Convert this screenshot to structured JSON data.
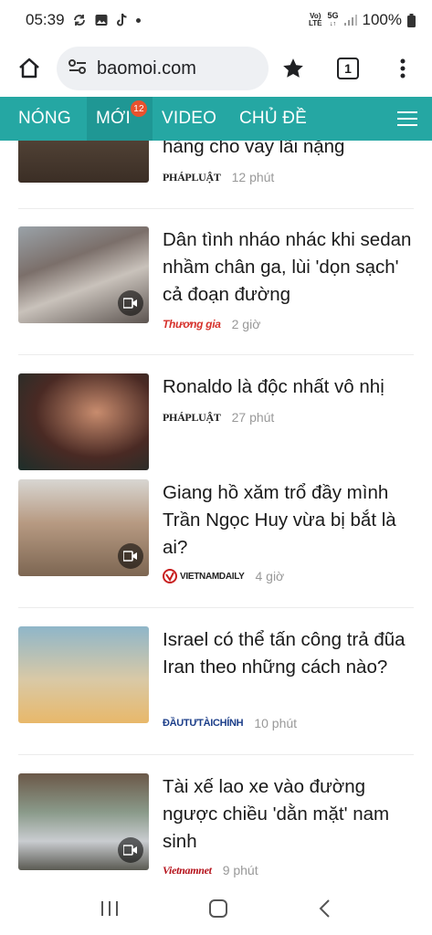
{
  "status": {
    "time": "05:39",
    "battery": "100%",
    "net_top": "Vo)\nLTE",
    "net_5g": "5G"
  },
  "browser": {
    "url": "baomoi.com",
    "tab_count": "1"
  },
  "nav": {
    "items": [
      {
        "label": "NÓNG"
      },
      {
        "label": "MỚI",
        "badge": "12"
      },
      {
        "label": "VIDEO"
      },
      {
        "label": "CHỦ ĐỀ"
      }
    ]
  },
  "articles": [
    {
      "title": "hàng cho vay lãi nặng",
      "source": "PHÁPLUẬT",
      "time": "12 phút"
    },
    {
      "title": "Dân tình nháo nhác khi sedan nhầm chân ga, lùi 'dọn sạch' cả đoạn đường",
      "source": "Thương gia",
      "time": "2 giờ"
    },
    {
      "title": "Ronaldo là độc nhất vô nhị",
      "source": "PHÁPLUẬT",
      "time": "27 phút"
    },
    {
      "title": "Giang hồ xăm trổ đầy mình Trần Ngọc Huy vừa bị bắt là ai?",
      "source": "VIETNAMDAILY",
      "time": "4 giờ"
    },
    {
      "title": "Israel có thể tấn công trả đũa Iran theo những cách nào?",
      "source": "ĐẦUTƯTÀICHÍNH",
      "time": "10 phút"
    },
    {
      "title": "Tài xế lao xe vào đường ngược chiều 'dằn mặt' nam sinh",
      "source": "Vietnamnet",
      "time": "9 phút"
    }
  ],
  "colors": {
    "nav_bg": "#25a7a3",
    "badge": "#e8522e"
  }
}
